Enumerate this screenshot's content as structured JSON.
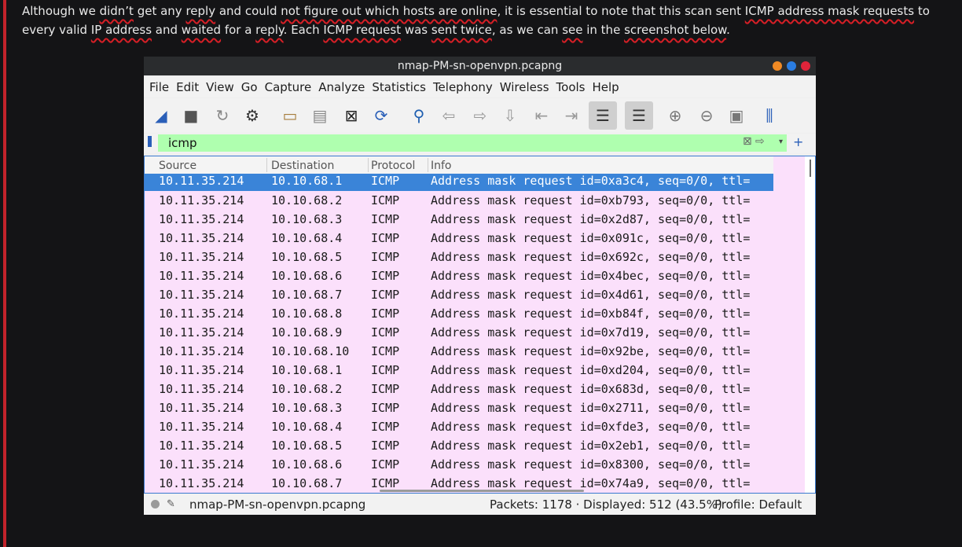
{
  "article": {
    "paragraph": [
      {
        "t": "Although we ",
        "u": false
      },
      {
        "t": "didn’t",
        "u": true
      },
      {
        "t": " get any ",
        "u": false
      },
      {
        "t": "reply",
        "u": true
      },
      {
        "t": " and could ",
        "u": false
      },
      {
        "t": "not figure out which hosts are online",
        "u": true
      },
      {
        "t": ", it is essential to note that this scan sent ",
        "u": false
      },
      {
        "t": "ICMP address mask requests",
        "u": true
      },
      {
        "t": " to every valid ",
        "u": false
      },
      {
        "t": "IP address",
        "u": true
      },
      {
        "t": " and ",
        "u": false
      },
      {
        "t": "waited",
        "u": true
      },
      {
        "t": " for a ",
        "u": false
      },
      {
        "t": "reply",
        "u": true
      },
      {
        "t": ". Each ",
        "u": false
      },
      {
        "t": "ICMP request",
        "u": true
      },
      {
        "t": " was ",
        "u": false
      },
      {
        "t": "sent twice",
        "u": true
      },
      {
        "t": ", as we can ",
        "u": false
      },
      {
        "t": "see",
        "u": true
      },
      {
        "t": " in the ",
        "u": false
      },
      {
        "t": "screenshot below",
        "u": true
      },
      {
        "t": ".",
        "u": false
      }
    ]
  },
  "window": {
    "title": "nmap-PM-sn-openvpn.pcapng",
    "buttons": [
      "#f08a24",
      "#2a7de1",
      "#e0243a"
    ]
  },
  "menu": [
    "File",
    "Edit",
    "View",
    "Go",
    "Capture",
    "Analyze",
    "Statistics",
    "Telephony",
    "Wireless",
    "Tools",
    "Help"
  ],
  "toolbar": [
    {
      "icon": "shark-fin-start-icon",
      "glyph": "◢",
      "color": "#2a5fb8"
    },
    {
      "icon": "stop-square-icon",
      "glyph": "■",
      "color": "#555"
    },
    {
      "icon": "restart-fin-icon",
      "glyph": "↻",
      "color": "#888"
    },
    {
      "icon": "gear-options-icon",
      "glyph": "⚙",
      "color": "#333"
    },
    {
      "icon": "open-folder-icon",
      "glyph": "▭",
      "color": "#a67c3c"
    },
    {
      "icon": "save-file-icon",
      "glyph": "▤",
      "color": "#888"
    },
    {
      "icon": "close-file-icon",
      "glyph": "⊠",
      "color": "#222"
    },
    {
      "icon": "reload-file-icon",
      "glyph": "⟳",
      "color": "#2a5fb8"
    },
    {
      "icon": "search-icon",
      "glyph": "⚲",
      "color": "#1f5fb0"
    },
    {
      "icon": "back-arrow-icon",
      "glyph": "⇦",
      "color": "#999"
    },
    {
      "icon": "forward-arrow-icon",
      "glyph": "⇨",
      "color": "#999"
    },
    {
      "icon": "goto-packet-icon",
      "glyph": "⇩",
      "color": "#999"
    },
    {
      "icon": "first-packet-icon",
      "glyph": "⇤",
      "color": "#999"
    },
    {
      "icon": "last-packet-icon",
      "glyph": "⇥",
      "color": "#999"
    },
    {
      "icon": "autoscroll-icon",
      "glyph": "☰",
      "color": "#333",
      "on": true
    },
    {
      "icon": "colorize-icon",
      "glyph": "☰",
      "color": "#333",
      "on": true
    },
    {
      "icon": "zoom-in-icon",
      "glyph": "⊕",
      "color": "#777"
    },
    {
      "icon": "zoom-out-icon",
      "glyph": "⊖",
      "color": "#777"
    },
    {
      "icon": "normal-size-icon",
      "glyph": "▣",
      "color": "#777"
    },
    {
      "icon": "resize-columns-icon",
      "glyph": "⫼",
      "color": "#2a5fb8"
    }
  ],
  "filter": {
    "value": "icmp"
  },
  "columns": [
    "Source",
    "Destination",
    "Protocol",
    "Info"
  ],
  "packets": [
    [
      "10.11.35.214",
      "10.10.68.1",
      "ICMP",
      "Address mask request id=0xa3c4, seq=0/0, ttl="
    ],
    [
      "10.11.35.214",
      "10.10.68.2",
      "ICMP",
      "Address mask request id=0xb793, seq=0/0, ttl="
    ],
    [
      "10.11.35.214",
      "10.10.68.3",
      "ICMP",
      "Address mask request id=0x2d87, seq=0/0, ttl="
    ],
    [
      "10.11.35.214",
      "10.10.68.4",
      "ICMP",
      "Address mask request id=0x091c, seq=0/0, ttl="
    ],
    [
      "10.11.35.214",
      "10.10.68.5",
      "ICMP",
      "Address mask request id=0x692c, seq=0/0, ttl="
    ],
    [
      "10.11.35.214",
      "10.10.68.6",
      "ICMP",
      "Address mask request id=0x4bec, seq=0/0, ttl="
    ],
    [
      "10.11.35.214",
      "10.10.68.7",
      "ICMP",
      "Address mask request id=0x4d61, seq=0/0, ttl="
    ],
    [
      "10.11.35.214",
      "10.10.68.8",
      "ICMP",
      "Address mask request id=0xb84f, seq=0/0, ttl="
    ],
    [
      "10.11.35.214",
      "10.10.68.9",
      "ICMP",
      "Address mask request id=0x7d19, seq=0/0, ttl="
    ],
    [
      "10.11.35.214",
      "10.10.68.10",
      "ICMP",
      "Address mask request id=0x92be, seq=0/0, ttl="
    ],
    [
      "10.11.35.214",
      "10.10.68.1",
      "ICMP",
      "Address mask request id=0xd204, seq=0/0, ttl="
    ],
    [
      "10.11.35.214",
      "10.10.68.2",
      "ICMP",
      "Address mask request id=0x683d, seq=0/0, ttl="
    ],
    [
      "10.11.35.214",
      "10.10.68.3",
      "ICMP",
      "Address mask request id=0x2711, seq=0/0, ttl="
    ],
    [
      "10.11.35.214",
      "10.10.68.4",
      "ICMP",
      "Address mask request id=0xfde3, seq=0/0, ttl="
    ],
    [
      "10.11.35.214",
      "10.10.68.5",
      "ICMP",
      "Address mask request id=0x2eb1, seq=0/0, ttl="
    ],
    [
      "10.11.35.214",
      "10.10.68.6",
      "ICMP",
      "Address mask request id=0x8300, seq=0/0, ttl="
    ],
    [
      "10.11.35.214",
      "10.10.68.7",
      "ICMP",
      "Address mask request id=0x74a9, seq=0/0, ttl="
    ]
  ],
  "status": {
    "file": "nmap-PM-sn-openvpn.pcapng",
    "packets": "Packets: 1178 · Displayed: 512 (43.5%)",
    "profile": "Profile: Default"
  }
}
